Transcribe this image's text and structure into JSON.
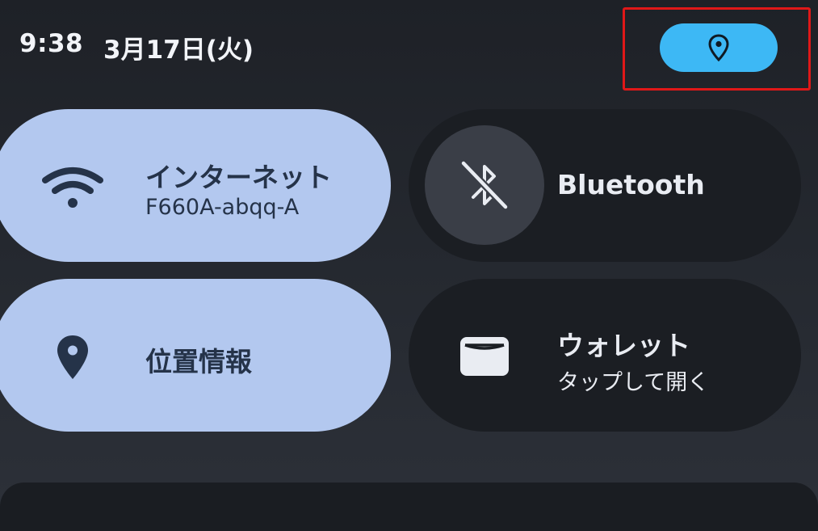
{
  "status": {
    "time": "9:38",
    "date": "3月17日(火)",
    "location_chip_icon": "location-pin-icon",
    "chip_color": "#3db8f5",
    "highlight_color": "#e01818"
  },
  "tiles": {
    "internet": {
      "title": "インターネット",
      "subtitle": "F660A-abqq-A",
      "icon": "wifi-icon",
      "state": "on"
    },
    "bluetooth": {
      "title": "Bluetooth",
      "icon": "bluetooth-off-icon",
      "state": "off"
    },
    "location": {
      "title": "位置情報",
      "icon": "location-pin-icon",
      "state": "on"
    },
    "wallet": {
      "title": "ウォレット",
      "subtitle": "タップして開く",
      "icon": "wallet-card-icon"
    }
  },
  "colors": {
    "tile_on": "#b3c8ef",
    "tile_off": "#1b1e23",
    "tile_on_text": "#253349",
    "tile_off_text": "#e9ecf2"
  }
}
